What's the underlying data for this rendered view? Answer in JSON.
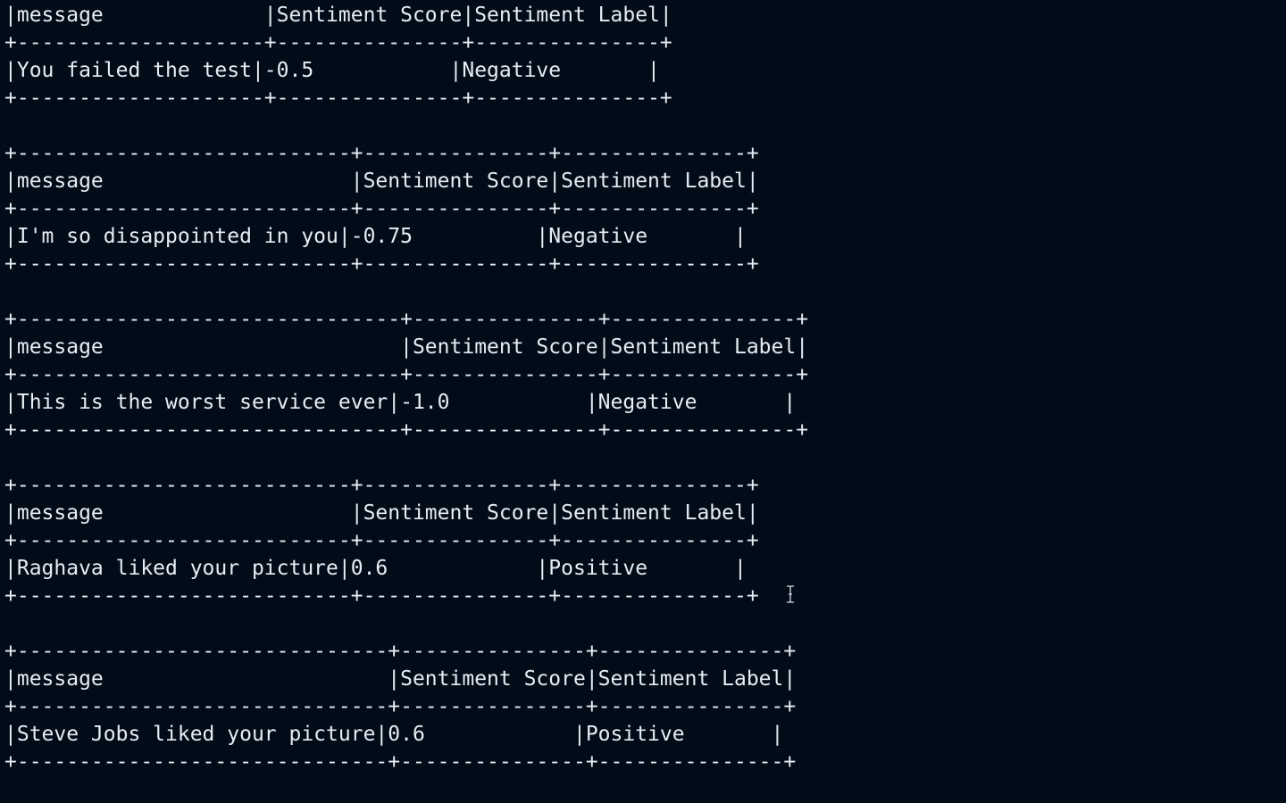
{
  "terminal": {
    "lines": [
      "|message             |Sentiment Score|Sentiment Label|",
      "+--------------------+---------------+---------------+",
      "|You failed the test|-0.5           |Negative       |",
      "+--------------------+---------------+---------------+",
      "",
      "+---------------------------+---------------+---------------+",
      "|message                    |Sentiment Score|Sentiment Label|",
      "+---------------------------+---------------+---------------+",
      "|I'm so disappointed in you|-0.75          |Negative       |",
      "+---------------------------+---------------+---------------+",
      "",
      "+-------------------------------+---------------+---------------+",
      "|message                        |Sentiment Score|Sentiment Label|",
      "+-------------------------------+---------------+---------------+",
      "|This is the worst service ever|-1.0           |Negative       |",
      "+-------------------------------+---------------+---------------+",
      "",
      "+---------------------------+---------------+---------------+",
      "|message                    |Sentiment Score|Sentiment Label|",
      "+---------------------------+---------------+---------------+",
      "|Raghava liked your picture|0.6            |Positive       |",
      "+---------------------------+---------------+---------------+",
      "",
      "+------------------------------+---------------+---------------+",
      "|message                       |Sentiment Score|Sentiment Label|",
      "+------------------------------+---------------+---------------+",
      "|Steve Jobs liked your picture|0.6            |Positive       |",
      "+------------------------------+---------------+---------------+"
    ]
  },
  "cursor": {
    "icon": "text-cursor-icon"
  }
}
